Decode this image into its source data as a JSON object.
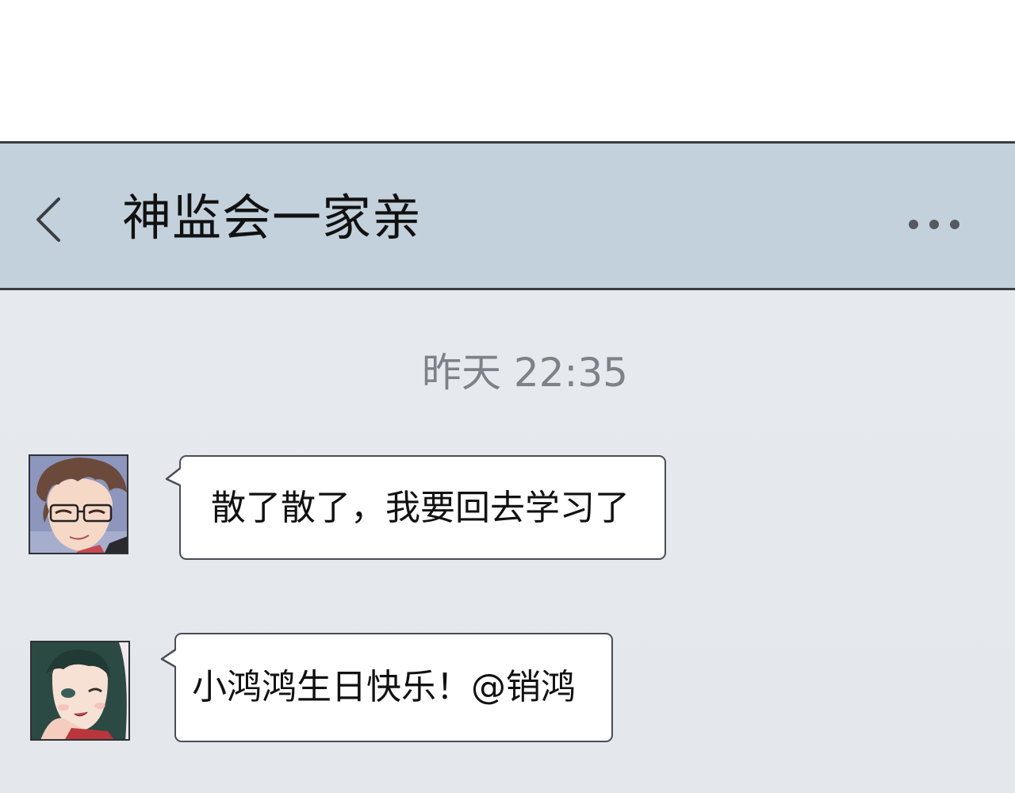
{
  "header": {
    "back_icon": "chevron-left-icon",
    "title": "神监会一家亲",
    "more_icon": "more-horizontal-icon",
    "background": "#c3d1dc"
  },
  "chat": {
    "timestamp": "昨天 22:35",
    "messages": [
      {
        "avatar": "avatar-boy-with-glasses",
        "text": "散了散了，我要回去学习了"
      },
      {
        "avatar": "avatar-girl-winking",
        "text": "小鸿鸿生日快乐！@销鸿"
      }
    ]
  }
}
